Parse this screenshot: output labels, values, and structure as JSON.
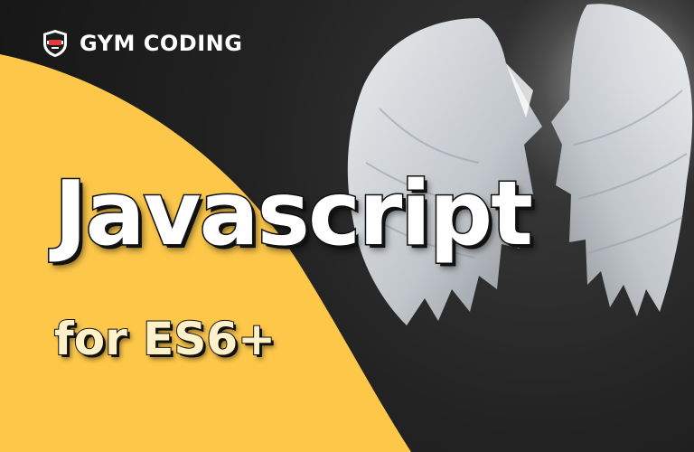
{
  "brand": {
    "name": "GYM CODING",
    "badge_icon": "gym-badge-icon"
  },
  "headline": {
    "title": "Javascript",
    "subtitle": "for ES6+"
  },
  "colors": {
    "background": "#1e1e1e",
    "accent_yellow": "#fdc84a",
    "title_text": "#ffffff",
    "subtitle_text": "#fff1c9"
  },
  "imagery": {
    "wings_icon": "angel-wings-icon"
  }
}
